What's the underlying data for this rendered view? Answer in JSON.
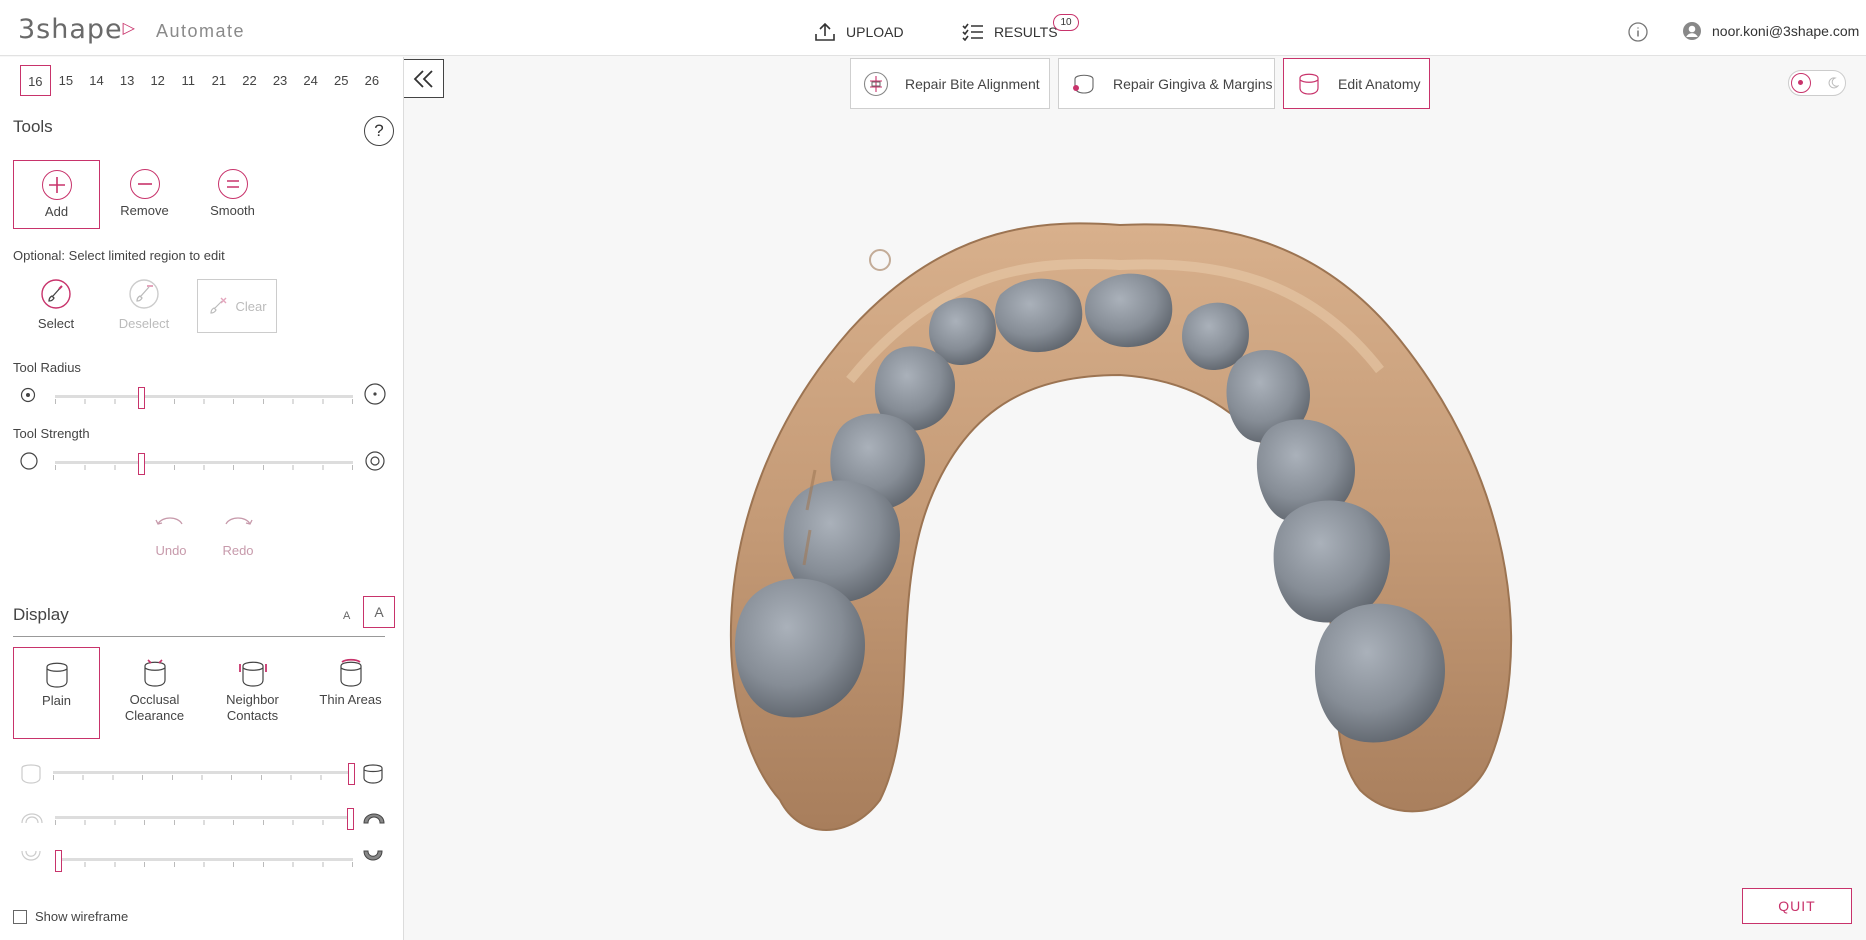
{
  "brand": {
    "logo_text": "3shape",
    "app_name": "Automate",
    "accent": "#c8336b"
  },
  "header": {
    "upload_label": "UPLOAD",
    "results_label": "RESULTS",
    "results_count": "10",
    "user_email": "noor.koni@3shape.com"
  },
  "teeth": {
    "selected": "16",
    "numbers": [
      "16",
      "15",
      "14",
      "13",
      "12",
      "11",
      "21",
      "22",
      "23",
      "24",
      "25",
      "26"
    ]
  },
  "tools": {
    "title": "Tools",
    "help": "?",
    "items": [
      {
        "label": "Add",
        "active": true
      },
      {
        "label": "Remove",
        "active": false
      },
      {
        "label": "Smooth",
        "active": false
      }
    ],
    "region_label": "Optional: Select limited region to edit",
    "select_label": "Select",
    "deselect_label": "Deselect",
    "clear_label": "Clear",
    "radius_label": "Tool Radius",
    "radius_value": 0.29,
    "strength_label": "Tool Strength",
    "strength_value": 0.29,
    "undo_label": "Undo",
    "redo_label": "Redo"
  },
  "display": {
    "title": "Display",
    "font_small": "A",
    "font_large": "A",
    "modes": [
      {
        "label": "Plain",
        "active": true
      },
      {
        "label": "Occlusal Clearance",
        "active": false
      },
      {
        "label": "Neighbor Contacts",
        "active": false
      },
      {
        "label": "Thin Areas",
        "active": false
      }
    ],
    "slider1_value": 1.0,
    "slider2_value": 0.99,
    "slider3_value": 0.01,
    "wireframe_label": "Show wireframe",
    "wireframe_checked": false
  },
  "workflow": [
    {
      "label": "Repair Bite Alignment",
      "icon": "bite-alignment-icon",
      "active": false
    },
    {
      "label": "Repair Gingiva & Margins",
      "icon": "gingiva-icon",
      "active": false
    },
    {
      "label": "Edit Anatomy",
      "icon": "anatomy-icon",
      "active": true
    }
  ],
  "quit_label": "QUIT",
  "colors": {
    "gum": "#c9a07d",
    "tooth": "#8d949d",
    "tooth_dark": "#5c6168"
  }
}
